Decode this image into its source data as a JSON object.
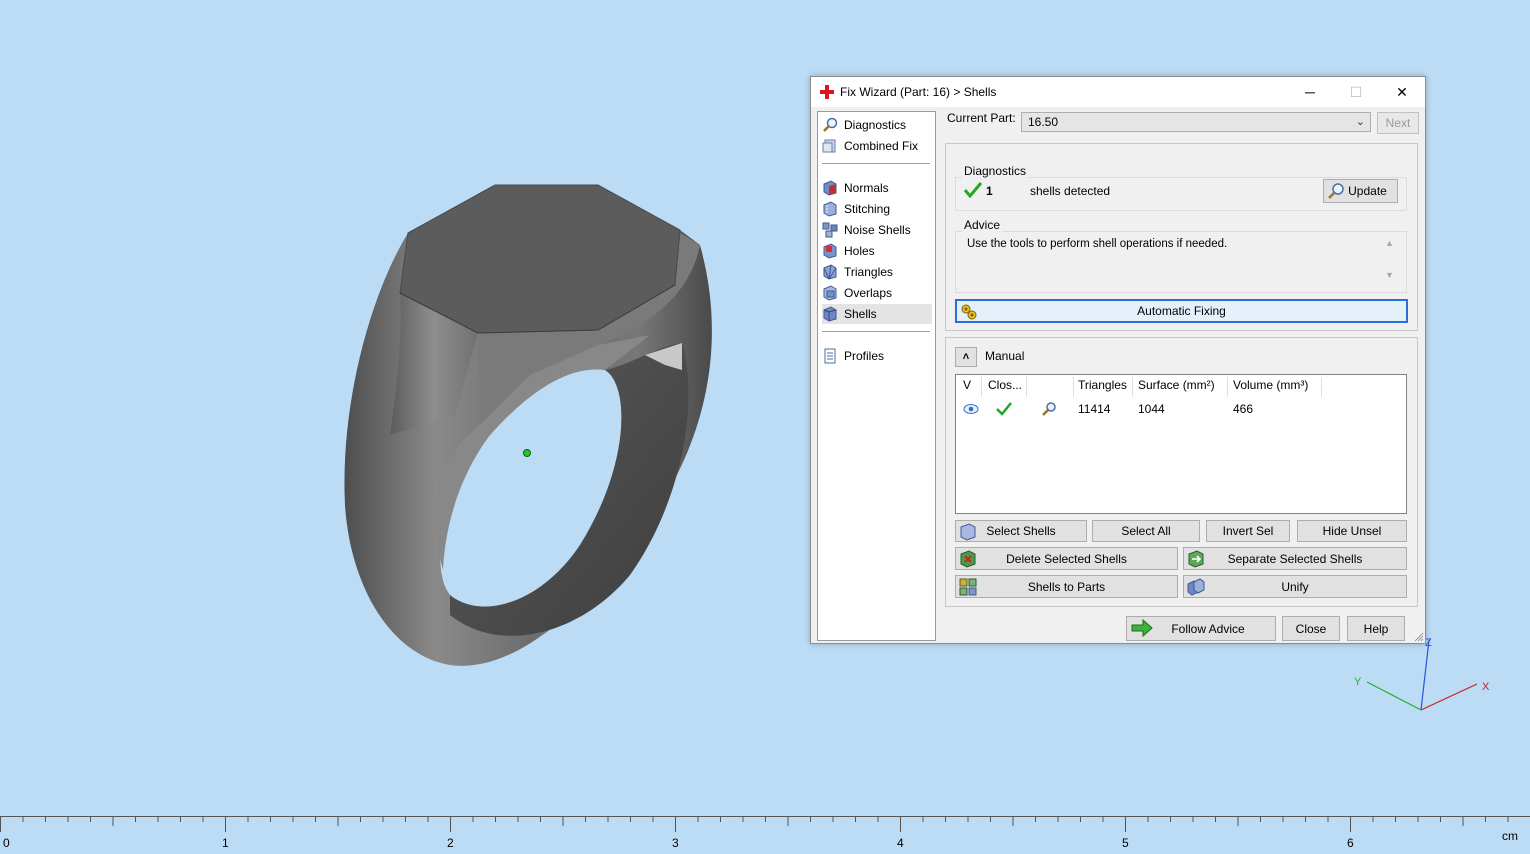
{
  "viewport": {
    "ruler": {
      "labels": [
        "0",
        "1",
        "2",
        "3",
        "4",
        "5",
        "6"
      ],
      "unit": "cm"
    },
    "axes": {
      "x": "X",
      "y": "Y",
      "z": "Z"
    }
  },
  "dialog": {
    "title": "Fix Wizard (Part: 16) > Shells",
    "window_buttons": {
      "minimize": "─",
      "maximize": "☐",
      "close": "✕"
    },
    "nav": {
      "items": [
        {
          "label": "Diagnostics",
          "icon": "magnifier-icon"
        },
        {
          "label": "Combined Fix",
          "icon": "combined-fix-icon"
        },
        {
          "label": "Normals",
          "icon": "normals-icon"
        },
        {
          "label": "Stitching",
          "icon": "stitching-icon"
        },
        {
          "label": "Noise Shells",
          "icon": "noise-shells-icon"
        },
        {
          "label": "Holes",
          "icon": "holes-icon"
        },
        {
          "label": "Triangles",
          "icon": "triangles-icon"
        },
        {
          "label": "Overlaps",
          "icon": "overlaps-icon"
        },
        {
          "label": "Shells",
          "icon": "shells-icon",
          "selected": true
        },
        {
          "label": "Profiles",
          "icon": "profiles-icon"
        }
      ]
    },
    "current_part": {
      "label": "Current Part:",
      "value": "16.50"
    },
    "next_button": "Next",
    "diagnostics": {
      "title": "Diagnostics",
      "count": "1",
      "text": "shells detected",
      "update_button": "Update"
    },
    "advice": {
      "title": "Advice",
      "text": "Use the tools to perform shell operations if needed."
    },
    "automatic_fixing_button": "Automatic Fixing",
    "manual": {
      "title": "Manual",
      "table": {
        "headers": [
          "V",
          "Clos...",
          "",
          "Triangles",
          "Surface (mm²)",
          "Volume (mm³)"
        ],
        "rows": [
          {
            "triangles": "11414",
            "surface": "1044",
            "volume": "466"
          }
        ]
      },
      "buttons": {
        "select_shells": "Select Shells",
        "select_all": "Select All",
        "invert_sel": "Invert Sel",
        "hide_unsel": "Hide Unsel",
        "delete_selected": "Delete Selected Shells",
        "separate_selected": "Separate Selected Shells",
        "shells_to_parts": "Shells to Parts",
        "unify": "Unify"
      }
    },
    "footer": {
      "follow_advice": "Follow Advice",
      "close": "Close",
      "help": "Help"
    }
  },
  "colors": {
    "background": "#bcdcf5",
    "check_green": "#22a822",
    "title_cross_red": "#e0141e"
  }
}
